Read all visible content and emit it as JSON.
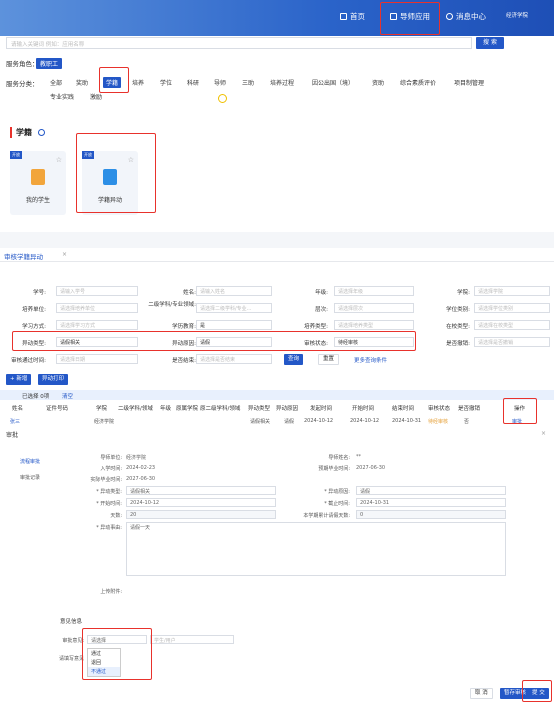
{
  "topbar": {
    "home": "首页",
    "guide_apps": "导师应用",
    "messages": "消息中心",
    "school": "经济学院"
  },
  "search": {
    "placeholder": "请输入关键词 例如：应用名称",
    "button": "搜 索"
  },
  "role": {
    "label": "服务角色：",
    "value": "教职工"
  },
  "categories": {
    "label": "服务分类：",
    "items": [
      "全部",
      "奖助",
      "学籍",
      "培养",
      "学位",
      "科研",
      "导师",
      "三助",
      "培养过程",
      "因公出国（境）",
      "资助",
      "综合素质评价",
      "项目制管理"
    ],
    "row2": [
      "专业实践",
      "激励"
    ],
    "active": "学籍"
  },
  "xueji": {
    "title": "学籍",
    "cards": [
      {
        "tag": "开放",
        "name": "我的学生"
      },
      {
        "tag": "开放",
        "name": "学籍异动"
      }
    ]
  },
  "tab": {
    "title": "审核学籍异动"
  },
  "filters": {
    "row1": [
      {
        "label": "学号:",
        "placeholder": "请输入学号"
      },
      {
        "label": "姓名:",
        "placeholder": "请输入姓名"
      },
      {
        "label": "年级:",
        "placeholder": "请选择年级"
      },
      {
        "label": "学院:",
        "placeholder": "请选择学院"
      }
    ],
    "row2": [
      {
        "label": "培养单位:",
        "placeholder": "请选择培养单位"
      },
      {
        "label": "二级学科/专业领域:",
        "placeholder": "请选择二级学科/专业..."
      },
      {
        "label": "层次:",
        "placeholder": "请选择层次"
      },
      {
        "label": "学位类别:",
        "placeholder": "请选择学位类别"
      }
    ],
    "row3": [
      {
        "label": "学习方式:",
        "placeholder": "请选择学习方式"
      },
      {
        "label": "学历教育:",
        "value": "是"
      },
      {
        "label": "培养类型:",
        "placeholder": "请选择培养类型"
      },
      {
        "label": "在校类型:",
        "placeholder": "请选择在校类型"
      }
    ],
    "row4": [
      {
        "label": "异动类型:",
        "value": "请假相关"
      },
      {
        "label": "异动原因:",
        "value": "请假"
      },
      {
        "label": "审核状态:",
        "value": "待经审核"
      },
      {
        "label": "是否撤销:",
        "placeholder": "请选择是否撤销"
      }
    ],
    "row5": [
      {
        "label": "审核通过时间:",
        "placeholder": "请选择日期"
      },
      {
        "label": "是否结束:",
        "placeholder": "请选择是否结束"
      }
    ],
    "query": "查询",
    "reset": "重置",
    "more": "更多查询条件"
  },
  "actions": {
    "new": "+ 新增",
    "print": "异动打印"
  },
  "selection": {
    "text": "已选择 0项",
    "clear": "清空"
  },
  "table": {
    "headers": [
      "姓名",
      "证件号码",
      "学院",
      "二级学科/领域",
      "年级",
      "原属学院",
      "原二级学科/领域",
      "异动类型",
      "异动原因",
      "发起时间",
      "开始时间",
      "结束时间",
      "审核状态",
      "是否撤销",
      "操作"
    ],
    "row": {
      "name": "张三",
      "college": "经济学院",
      "type": "请假相关",
      "reason": "请假",
      "start": "2024-10-12",
      "begin": "2024-10-12",
      "end": "2024-10-31",
      "status": "待经审核",
      "cancelled": "否",
      "op": "审批"
    }
  },
  "review": {
    "title": "审批",
    "side": [
      "流程审批",
      "审批记录"
    ],
    "info": [
      {
        "label": "导师单位:",
        "value": "经济学院"
      },
      {
        "label": "导师姓名:",
        "value": "**"
      },
      {
        "label": "入学时间:",
        "value": "2024-02-23"
      },
      {
        "label": "预期毕业时间:",
        "value": "2027-06-30"
      },
      {
        "label": "实际毕业时间:",
        "value": "2027-06-30"
      }
    ],
    "form": {
      "type_label": "* 异动类型:",
      "type_value": "请假相关",
      "reason_label": "* 异动原因:",
      "reason_value": "请假",
      "start_label": "* 开始时间:",
      "start_value": "2024-10-12",
      "end_label": "* 截止时间:",
      "end_value": "2024-10-31",
      "days_label": "天数:",
      "days_value": "20",
      "leave_label": "本学期累计请假天数:",
      "leave_value": "0",
      "cause_label": "* 异动事由:",
      "cause_value": "请假一天",
      "attach_label": "上传附件:"
    },
    "opinion": {
      "section": "意见信息",
      "label": "审批意见:",
      "value": "请选择",
      "user_placeholder": "学生/用户",
      "comment_label": "请填写意见",
      "options": [
        "通过",
        "退回",
        "不通过"
      ]
    },
    "buttons": {
      "cancel": "取 消",
      "save": "暂存审核",
      "submit": "提 交"
    }
  },
  "colors": {
    "primary": "#2357c7",
    "highlight": "#e8322c"
  }
}
